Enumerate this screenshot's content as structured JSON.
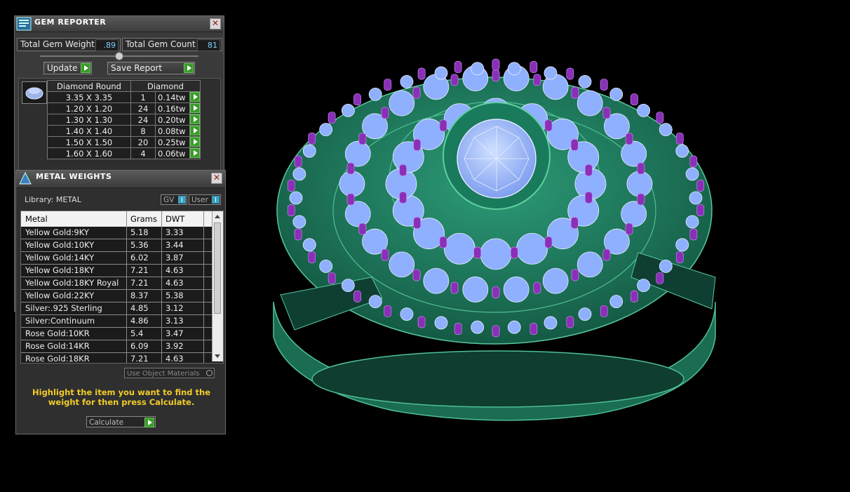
{
  "gem_reporter": {
    "title": "GEM REPORTER",
    "total_weight_label": "Total Gem Weight",
    "total_weight_value": ".89",
    "total_count_label": "Total Gem Count",
    "total_count_value": "81",
    "update_label": "Update",
    "save_label": "Save Report",
    "table": {
      "header_shape": "Diamond Round",
      "header_material": "Diamond",
      "rows": [
        {
          "size": "3.35 X 3.35",
          "count": "1",
          "weight": "0.14tw"
        },
        {
          "size": "1.20 X 1.20",
          "count": "24",
          "weight": "0.16tw"
        },
        {
          "size": "1.30 X 1.30",
          "count": "24",
          "weight": "0.20tw"
        },
        {
          "size": "1.40 X 1.40",
          "count": "8",
          "weight": "0.08tw"
        },
        {
          "size": "1.50 X 1.50",
          "count": "20",
          "weight": "0.25tw"
        },
        {
          "size": "1.60 X 1.60",
          "count": "4",
          "weight": "0.06tw"
        }
      ]
    }
  },
  "metal_weights": {
    "title": "METAL WEIGHTS",
    "library_label": "Library: METAL",
    "toggle_gv": "GV",
    "toggle_user": "User",
    "columns": [
      "Metal",
      "Grams",
      "DWT"
    ],
    "rows": [
      {
        "metal": "Yellow Gold:9KY",
        "grams": "5.18",
        "dwt": "3.33"
      },
      {
        "metal": "Yellow Gold:10KY",
        "grams": "5.36",
        "dwt": "3.44"
      },
      {
        "metal": "Yellow Gold:14KY",
        "grams": "6.02",
        "dwt": "3.87"
      },
      {
        "metal": "Yellow Gold:18KY",
        "grams": "7.21",
        "dwt": "4.63"
      },
      {
        "metal": "Yellow Gold:18KY Royal",
        "grams": "7.21",
        "dwt": "4.63"
      },
      {
        "metal": "Yellow Gold:22KY",
        "grams": "8.37",
        "dwt": "5.38"
      },
      {
        "metal": "Silver:.925 Sterling",
        "grams": "4.85",
        "dwt": "3.12"
      },
      {
        "metal": "Silver:Continuum",
        "grams": "4.86",
        "dwt": "3.13"
      },
      {
        "metal": "Rose Gold:10KR",
        "grams": "5.4",
        "dwt": "3.47"
      },
      {
        "metal": "Rose Gold:14KR",
        "grams": "6.09",
        "dwt": "3.92"
      },
      {
        "metal": "Rose Gold:18KR",
        "grams": "7.21",
        "dwt": "4.63"
      }
    ],
    "use_object_materials_label": "Use Object Materials",
    "hint": "Highlight the item you want to find the weight for then press Calculate.",
    "calculate_label": "Calculate"
  },
  "colors": {
    "metal_green": "#1e7a5e",
    "prong_purple": "#8a2fb8",
    "stone_blue": "#8fb0ff",
    "hint_yellow": "#f1cb2a",
    "go_green": "#3c9a2c"
  }
}
